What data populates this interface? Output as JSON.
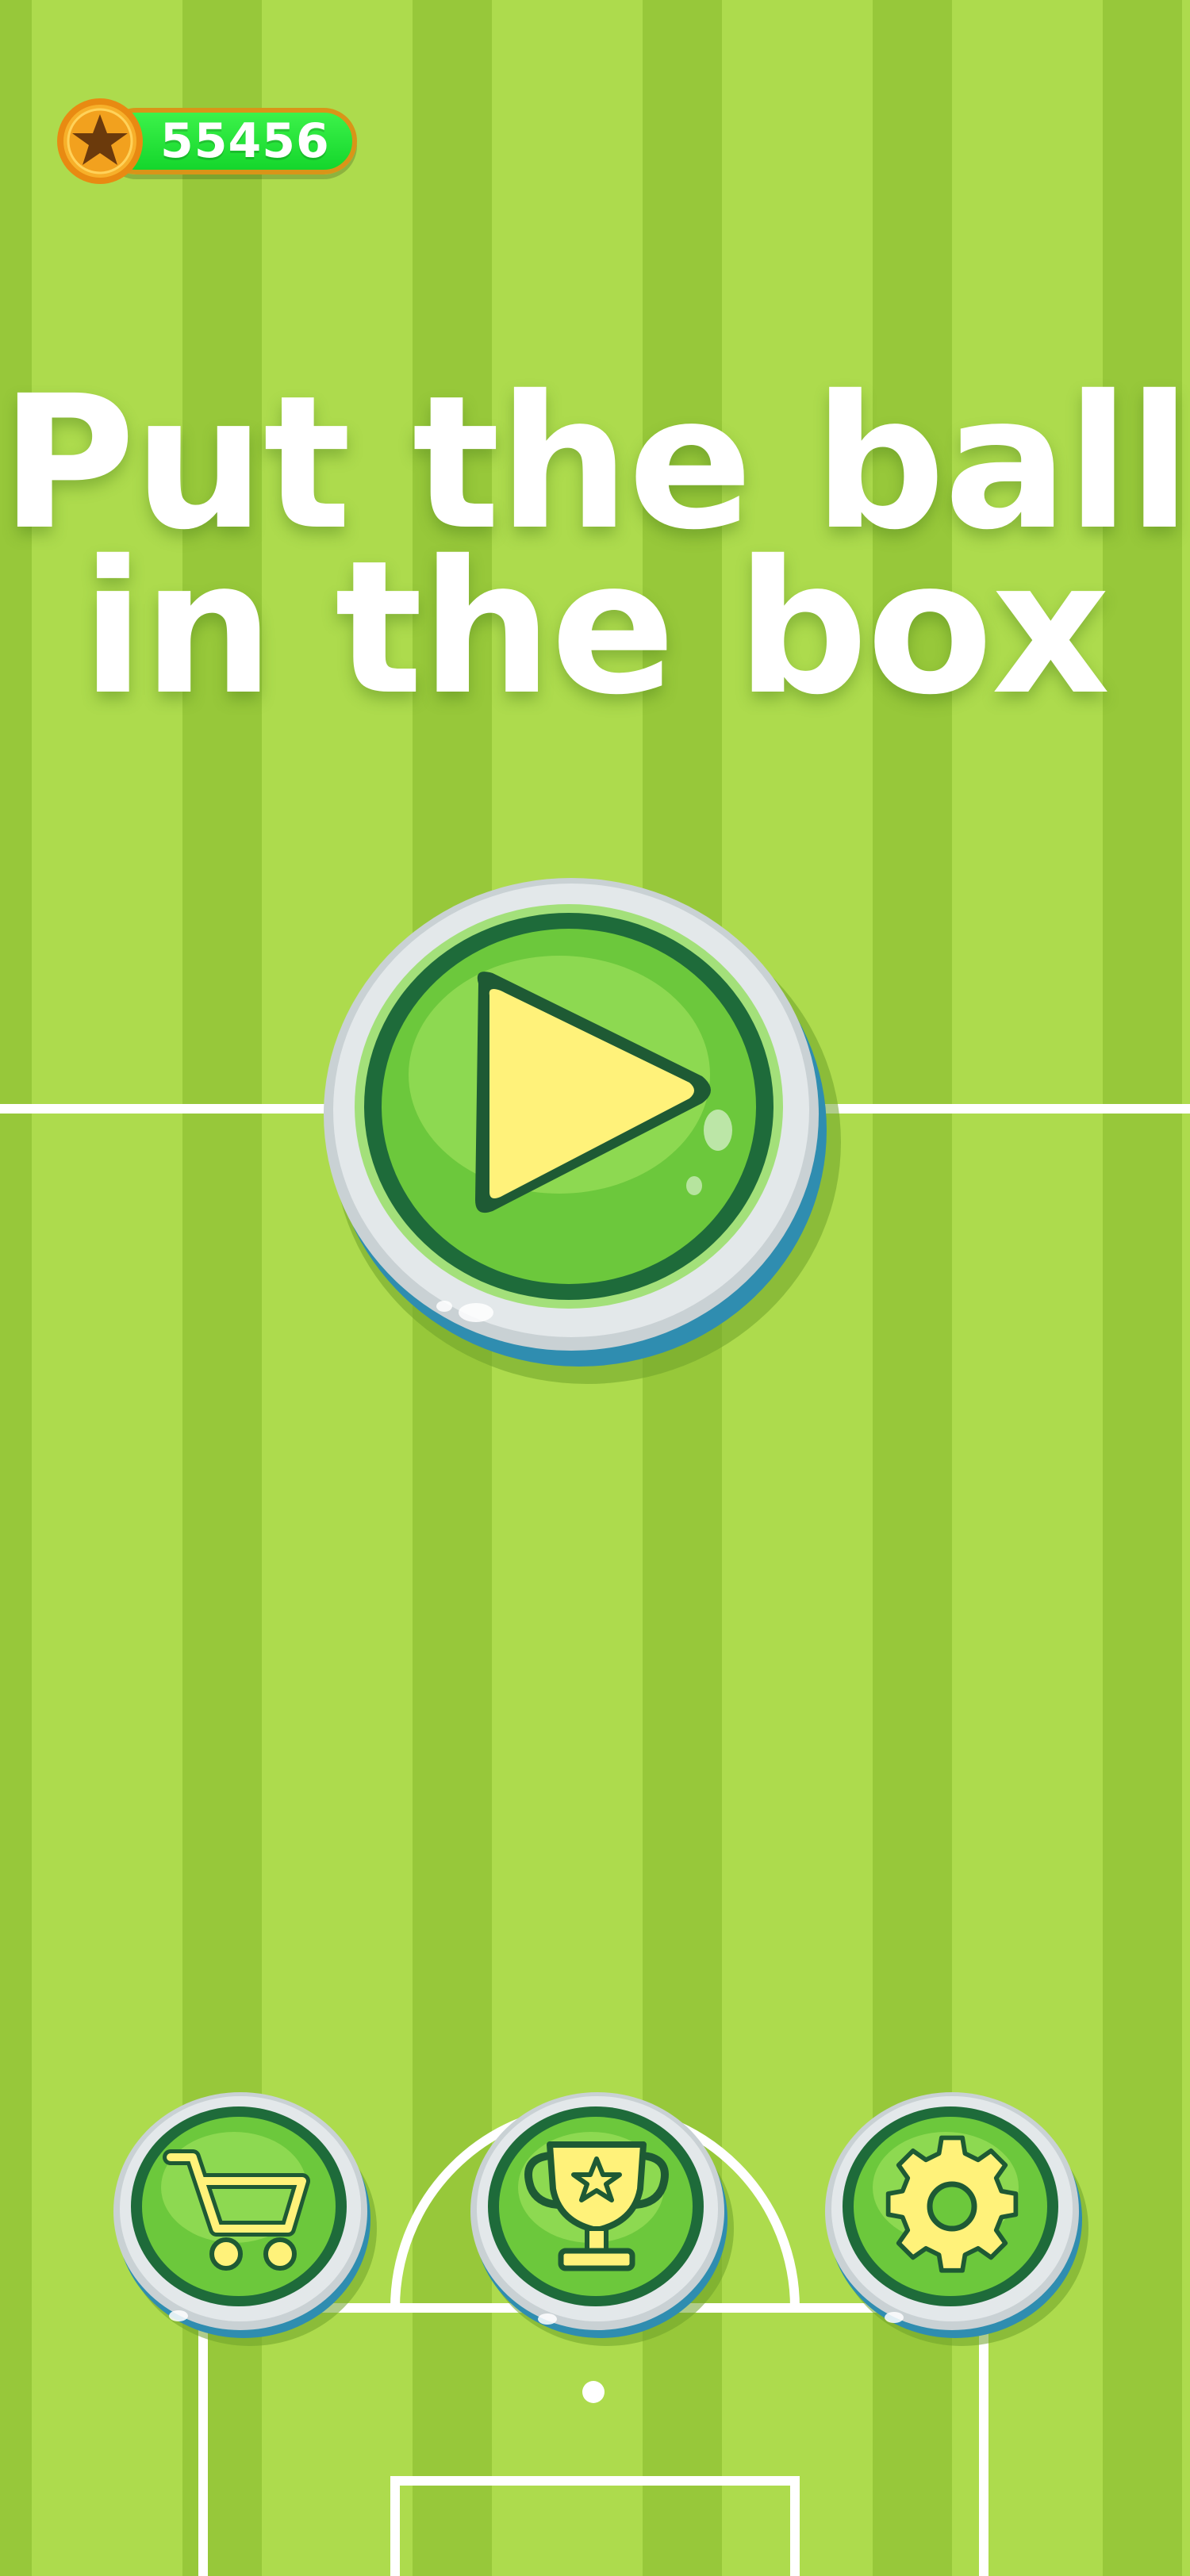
{
  "game": {
    "title_line1": "Put the ball",
    "title_line2": "in the box"
  },
  "hud": {
    "coins": "55456",
    "coin_icon": "star-coin-icon"
  },
  "buttons": {
    "play": {
      "icon": "play-icon"
    },
    "shop": {
      "icon": "shopping-cart-icon"
    },
    "leaderboard": {
      "icon": "trophy-icon"
    },
    "settings": {
      "icon": "gear-icon"
    }
  },
  "colors": {
    "grass_light": "#addb4d",
    "grass_dark": "#97c83a",
    "button_green": "#5ec23a",
    "button_border": "#1e6b3a",
    "play_triangle": "#fff27a",
    "coin_pill": "#22e23a",
    "coin_gold": "#f5a623"
  }
}
